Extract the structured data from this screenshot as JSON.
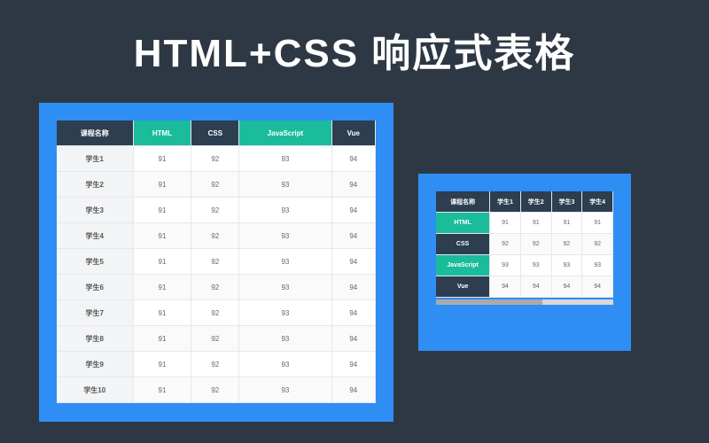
{
  "title": "HTML+CSS 响应式表格",
  "leftTable": {
    "headers": [
      "课程名称",
      "HTML",
      "CSS",
      "JavaScript",
      "Vue"
    ],
    "rows": [
      {
        "label": "学生1",
        "cells": [
          "91",
          "92",
          "93",
          "94"
        ]
      },
      {
        "label": "学生2",
        "cells": [
          "91",
          "92",
          "93",
          "94"
        ]
      },
      {
        "label": "学生3",
        "cells": [
          "91",
          "92",
          "93",
          "94"
        ]
      },
      {
        "label": "学生4",
        "cells": [
          "91",
          "92",
          "93",
          "94"
        ]
      },
      {
        "label": "学生5",
        "cells": [
          "91",
          "92",
          "93",
          "94"
        ]
      },
      {
        "label": "学生6",
        "cells": [
          "91",
          "92",
          "93",
          "94"
        ]
      },
      {
        "label": "学生7",
        "cells": [
          "91",
          "92",
          "93",
          "94"
        ]
      },
      {
        "label": "学生8",
        "cells": [
          "91",
          "92",
          "93",
          "94"
        ]
      },
      {
        "label": "学生9",
        "cells": [
          "91",
          "92",
          "93",
          "94"
        ]
      },
      {
        "label": "学生10",
        "cells": [
          "91",
          "92",
          "93",
          "94"
        ]
      }
    ]
  },
  "rightTable": {
    "headers": [
      "课程名称",
      "学生1",
      "学生2",
      "学生3",
      "学生4"
    ],
    "rows": [
      {
        "label": "HTML",
        "cells": [
          "91",
          "91",
          "91",
          "91"
        ]
      },
      {
        "label": "CSS",
        "cells": [
          "92",
          "92",
          "92",
          "92"
        ]
      },
      {
        "label": "JavaScript",
        "cells": [
          "93",
          "93",
          "93",
          "93"
        ]
      },
      {
        "label": "Vue",
        "cells": [
          "94",
          "94",
          "94",
          "94"
        ]
      }
    ]
  }
}
